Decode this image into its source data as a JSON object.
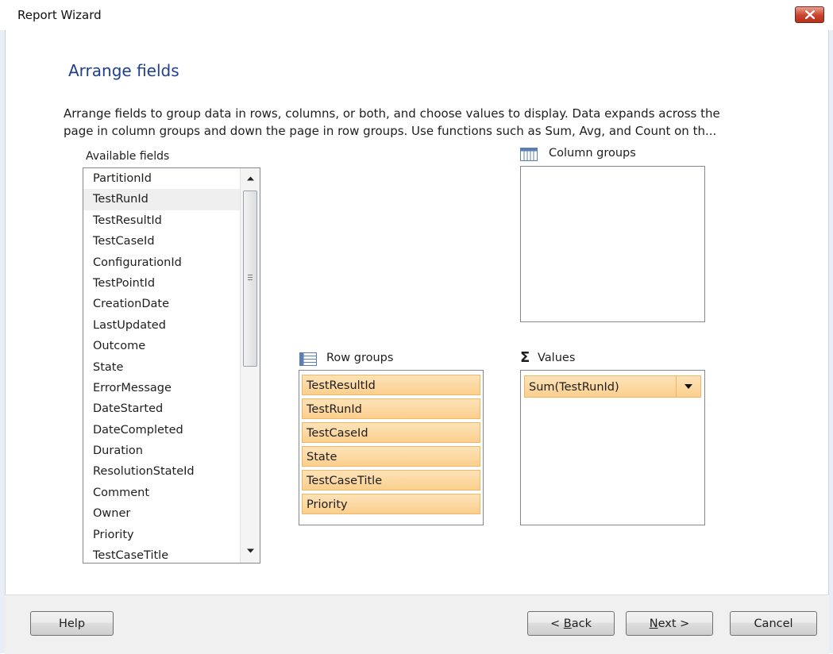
{
  "window": {
    "title": "Report Wizard"
  },
  "page": {
    "heading": "Arrange fields",
    "description_line1": "Arrange fields to group data in rows, columns, or both, and choose values to display. Data expands across the",
    "description_line2": "page in column groups and down the page in row groups.  Use functions such as Sum, Avg, and Count on th..."
  },
  "available_fields": {
    "label": "Available fields",
    "selected": "TestRunId",
    "items": [
      "PartitionId",
      "TestRunId",
      "TestResultId",
      "TestCaseId",
      "ConfigurationId",
      "TestPointId",
      "CreationDate",
      "LastUpdated",
      "Outcome",
      "State",
      "ErrorMessage",
      "DateStarted",
      "DateCompleted",
      "Duration",
      "ResolutionStateId",
      "Comment",
      "Owner",
      "Priority",
      "TestCaseTitle"
    ]
  },
  "column_groups": {
    "label": "Column groups",
    "items": []
  },
  "row_groups": {
    "label": "Row groups",
    "items": [
      "TestResultId",
      "TestRunId",
      "TestCaseId",
      "State",
      "TestCaseTitle",
      "Priority"
    ]
  },
  "values": {
    "label": "Values",
    "symbol": "Σ",
    "items": [
      "Sum(TestRunId)"
    ]
  },
  "buttons": {
    "help": "Help",
    "back_prefix": "< ",
    "back_key": "B",
    "back_rest": "ack",
    "next_key": "N",
    "next_rest": "ext >",
    "cancel": "Cancel"
  },
  "icons": {
    "close": "close-icon",
    "column_groups": "column-grid-icon",
    "row_groups": "row-list-icon",
    "values": "sigma-icon"
  },
  "colors": {
    "heading": "#1f3f8f",
    "chip_fill": "#fbcf8d",
    "chip_border": "#f0b865",
    "close_button": "#c8432b"
  }
}
